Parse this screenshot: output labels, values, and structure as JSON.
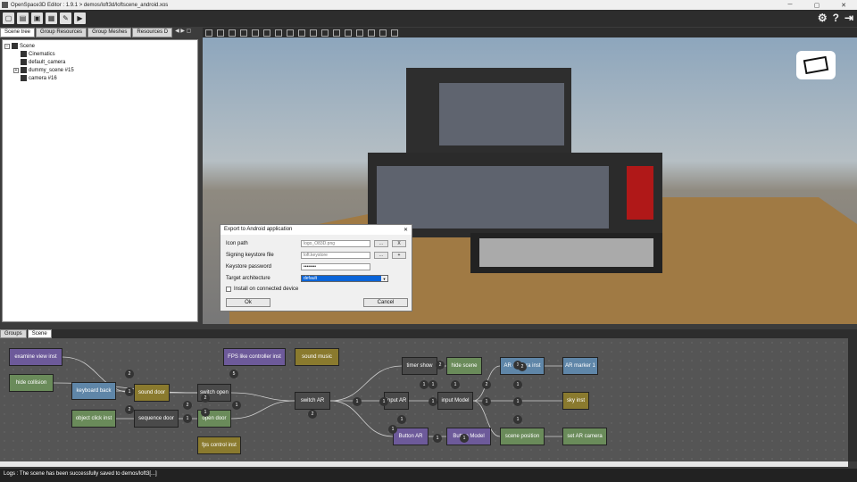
{
  "window": {
    "title": "OpenSpace3D Editor : 1.9.1 > demos/loft3d/loftscene_android.xos",
    "controls": [
      "─",
      "▢",
      "✕"
    ]
  },
  "toolbar": {
    "right_icons": [
      "gear-icon",
      "help-icon",
      "exit-icon"
    ]
  },
  "left_panel": {
    "tabs": [
      "Scene tree",
      "Group Resources",
      "Group Meshes",
      "Resources D"
    ],
    "tree": [
      {
        "label": "Scene",
        "expander": "−"
      },
      {
        "label": "Cinematics",
        "expander": ""
      },
      {
        "label": "default_camera",
        "expander": ""
      },
      {
        "label": "dummy_scene #15",
        "expander": "+"
      },
      {
        "label": "camera #16",
        "expander": ""
      }
    ]
  },
  "dialog": {
    "title": "Export to Android application",
    "close": "✕",
    "icon_path_label": "Icon path",
    "icon_path_value": "logo_O83D.png",
    "icon_path_browse": "...",
    "icon_path_clear": "X",
    "keystore_label": "Signing keystore file",
    "keystore_value": "loft.keystore",
    "keystore_browse": "...",
    "keystore_add": "+",
    "password_label": "Keystore password",
    "password_value": "••••••••",
    "arch_label": "Target architecture",
    "arch_value": "default",
    "install_label": "Install on connected device",
    "ok": "Ok",
    "cancel": "Cancel"
  },
  "bottom_tabs": [
    "Groups",
    "Scene"
  ],
  "graph": {
    "nodes": [
      {
        "label": "examine view inst"
      },
      {
        "label": "hide collision"
      },
      {
        "label": "keyboard back"
      },
      {
        "label": "object click inst"
      },
      {
        "label": "sound door"
      },
      {
        "label": "sequence door"
      },
      {
        "label": "switch open"
      },
      {
        "label": "open door"
      },
      {
        "label": "fps control inst"
      },
      {
        "label": "FPS like controller inst"
      },
      {
        "label": "sound music"
      },
      {
        "label": "switch AR"
      },
      {
        "label": "input AR"
      },
      {
        "label": "Button AR"
      },
      {
        "label": "timer show"
      },
      {
        "label": "hide scene"
      },
      {
        "label": "input Model"
      },
      {
        "label": "Button Model"
      },
      {
        "label": "AR camera inst"
      },
      {
        "label": "AR marker 1"
      },
      {
        "label": "sky inst"
      },
      {
        "label": "scene position"
      },
      {
        "label": "set AR camera"
      }
    ],
    "ports": [
      "2",
      "5",
      "1",
      "2",
      "2",
      "1",
      "2",
      "1",
      "1",
      "2",
      "1",
      "1",
      "1",
      "1",
      "1",
      "1",
      "2",
      "1",
      "1",
      "1",
      "1",
      "2",
      "1",
      "1",
      "1",
      "1",
      "1",
      "2"
    ]
  },
  "logs": {
    "text": "Logs : The scene has been successfully saved to demos/loft3[...]"
  }
}
